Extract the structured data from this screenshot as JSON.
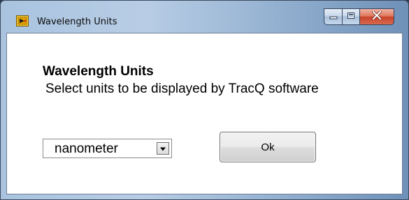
{
  "window": {
    "title": "Wavelength Units",
    "app_icon": "labview-icon",
    "caption_buttons": [
      "minimize-icon",
      "maximize-icon",
      "close-icon"
    ]
  },
  "dialog": {
    "heading": "Wavelength Units",
    "subheading": "Select units to be displayed by TracQ software"
  },
  "units_select": {
    "value": "nanometer"
  },
  "ok_button": {
    "label": "Ok"
  },
  "colors": {
    "close_button": "#c8432a",
    "titlebar": "#a9c3df",
    "client_bg": "#ffffff"
  }
}
